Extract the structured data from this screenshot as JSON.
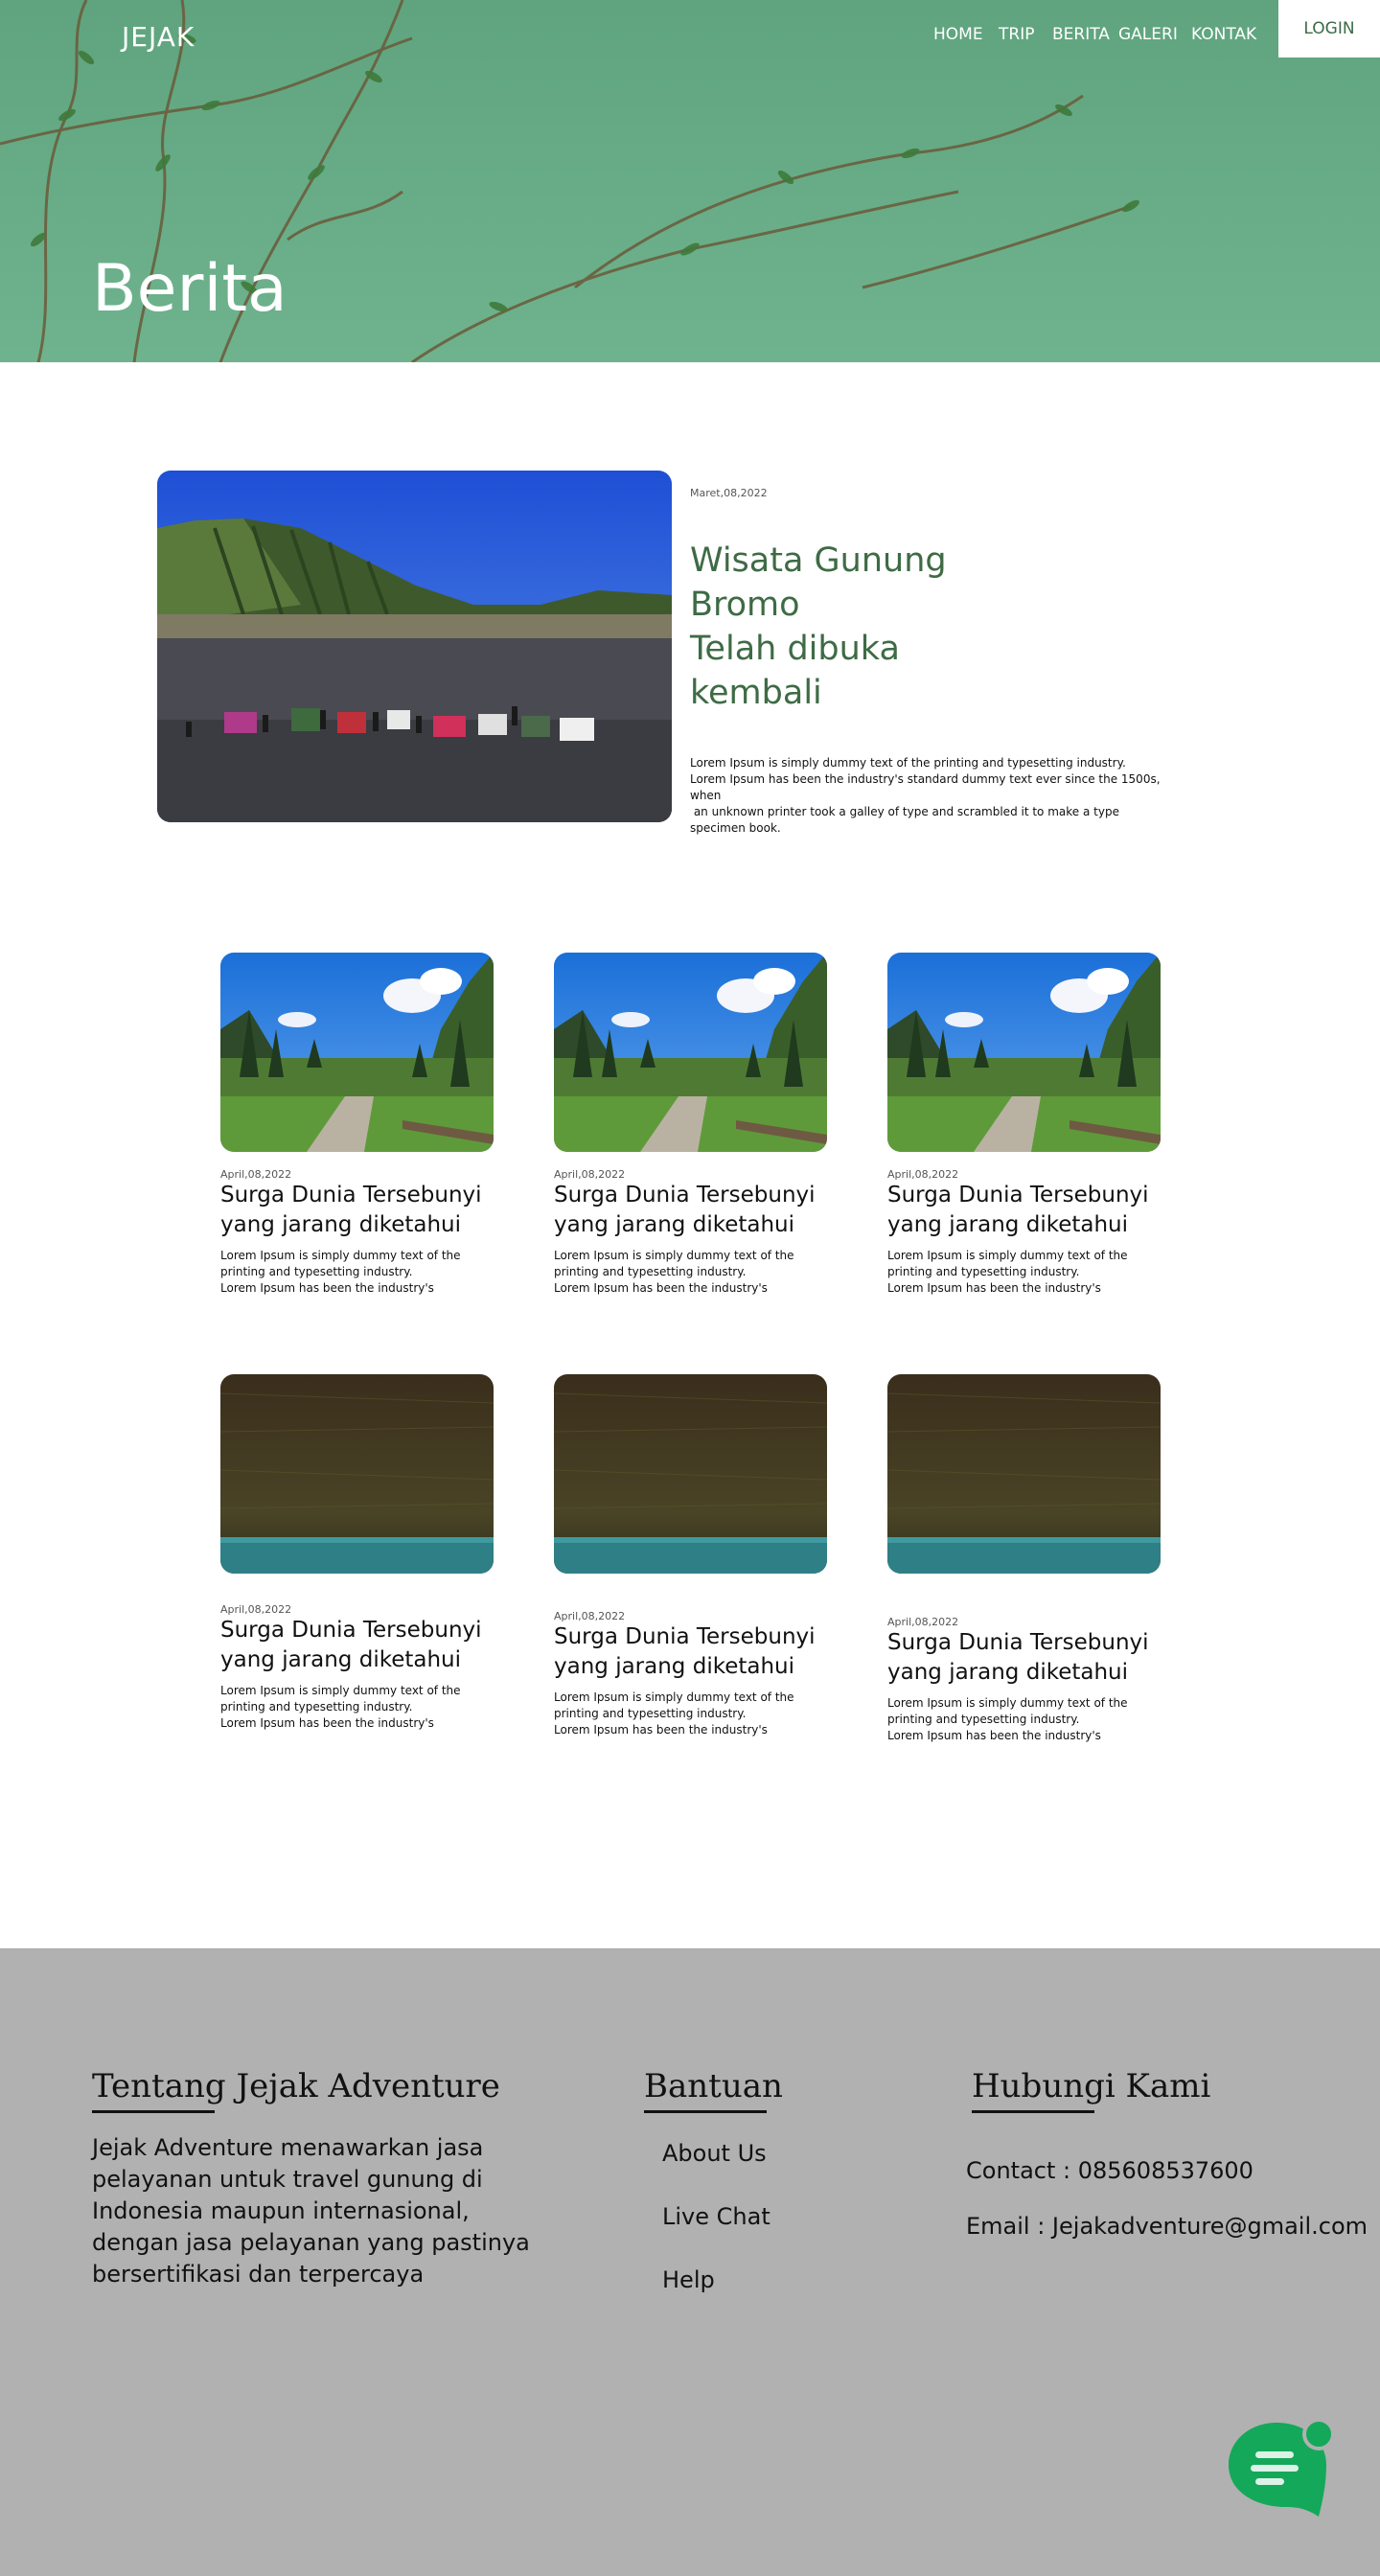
{
  "header": {
    "logo": "JEJAK",
    "nav": [
      "HOME",
      "TRIP",
      "BERITA",
      "GALERI",
      "KONTAK"
    ],
    "login": "LOGIN",
    "title": "Berita"
  },
  "featured": {
    "date": "Maret,08,2022",
    "title_lines": [
      "Wisata Gunung",
      "Bromo",
      "Telah dibuka",
      "kembali"
    ],
    "desc_lines": [
      "Lorem Ipsum is simply dummy text of the printing and typesetting industry.",
      "Lorem Ipsum has been the industry's standard dummy text ever since the 1500s, when",
      " an unknown printer took a galley of type and scrambled it to make a type",
      "specimen book."
    ]
  },
  "cards": [
    {
      "date": "April,08,2022",
      "title_lines": [
        "Surga Dunia Tersebunyi",
        "yang jarang diketahui"
      ],
      "desc_lines": [
        "Lorem Ipsum is simply dummy text of the",
        "printing and typesetting industry.",
        "Lorem Ipsum has been the industry's"
      ],
      "image": "mountain-valley-road"
    },
    {
      "date": "April,08,2022",
      "title_lines": [
        "Surga Dunia Tersebunyi",
        "yang jarang diketahui"
      ],
      "desc_lines": [
        "Lorem Ipsum is simply dummy text of the",
        "printing and typesetting industry.",
        "Lorem Ipsum has been the industry's"
      ],
      "image": "mountain-valley-road"
    },
    {
      "date": "April,08,2022",
      "title_lines": [
        "Surga Dunia Tersebunyi",
        "yang jarang diketahui"
      ],
      "desc_lines": [
        "Lorem Ipsum is simply dummy text of the",
        "printing and typesetting industry.",
        "Lorem Ipsum has been the industry's"
      ],
      "image": "mountain-valley-road"
    },
    {
      "date": "April,08,2022",
      "title_lines": [
        "Surga Dunia Tersebunyi",
        "yang jarang diketahui"
      ],
      "desc_lines": [
        "Lorem Ipsum is simply dummy text of the",
        "printing and typesetting industry.",
        "Lorem Ipsum has been the industry's"
      ],
      "image": "forest-lake"
    },
    {
      "date": "April,08,2022",
      "title_lines": [
        "Surga Dunia Tersebunyi",
        "yang jarang diketahui"
      ],
      "desc_lines": [
        "Lorem Ipsum is simply dummy text of the",
        "printing and typesetting industry.",
        "Lorem Ipsum has been the industry's"
      ],
      "image": "forest-lake"
    },
    {
      "date": "April,08,2022",
      "title_lines": [
        "Surga Dunia Tersebunyi",
        "yang jarang diketahui"
      ],
      "desc_lines": [
        "Lorem Ipsum is simply dummy text of the",
        "printing and typesetting industry.",
        "Lorem Ipsum has been the industry's"
      ],
      "image": "forest-lake"
    }
  ],
  "footer": {
    "about": {
      "heading": "Tentang Jejak Adventure",
      "lines": [
        "Jejak Adventure menawarkan jasa",
        "pelayanan untuk travel gunung di",
        "Indonesia maupun internasional,",
        "dengan jasa pelayanan yang pastinya",
        "bersertifikasi dan terpercaya"
      ]
    },
    "help": {
      "heading": "Bantuan",
      "links": [
        "About Us",
        "Live Chat",
        "Help"
      ]
    },
    "contact": {
      "heading": "Hubungi Kami",
      "phone": "Contact : 085608537600",
      "email": "Email : Jejakadventure@gmail.com"
    }
  },
  "colors": {
    "hero_green": "#66ab86",
    "title_green": "#3e6b45",
    "footer_gray": "#b1b1b1",
    "chat_green": "#14a85a"
  },
  "icons": [
    "chat-icon"
  ]
}
